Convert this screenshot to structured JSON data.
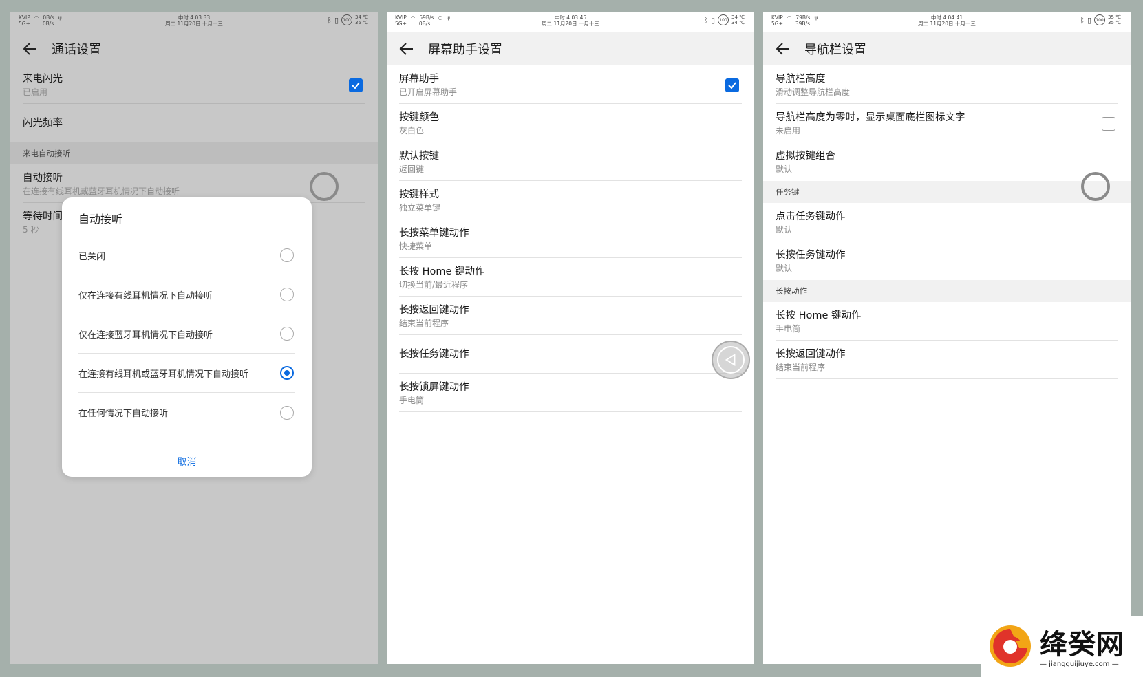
{
  "status_left": [
    "KVIP",
    "5G+"
  ],
  "phones": [
    {
      "status": {
        "speed_up": "0B/s",
        "speed_down": "0B/s",
        "time": "中时 4:03:33",
        "date": "周二 11月20日 十月十三",
        "battery": "100",
        "temp1": "34 ℃",
        "temp2": "35 ℃"
      },
      "title": "通话设置",
      "items": [
        {
          "title": "来电闪光",
          "sub": "已启用"
        },
        {
          "title": "闪光频率"
        }
      ],
      "section": "来电自动接听",
      "items2": [
        {
          "title": "自动接听",
          "sub": "在连接有线耳机或蓝牙耳机情况下自动接听"
        },
        {
          "title": "等待时间",
          "sub": "5 秒"
        }
      ],
      "dialog": {
        "title": "自动接听",
        "options": [
          "已关闭",
          "仅在连接有线耳机情况下自动接听",
          "仅在连接蓝牙耳机情况下自动接听",
          "在连接有线耳机或蓝牙耳机情况下自动接听",
          "在任何情况下自动接听"
        ],
        "selected_index": 3,
        "cancel": "取消"
      }
    },
    {
      "status": {
        "speed_up": "59B/s",
        "speed_down": "0B/s",
        "time": "中时 4:03:45",
        "date": "周二 11月20日 十月十三",
        "battery": "100",
        "temp1": "34 ℃",
        "temp2": "34 ℃"
      },
      "title": "屏幕助手设置",
      "items": [
        {
          "title": "屏幕助手",
          "sub": "已开启屏幕助手"
        },
        {
          "title": "按键颜色",
          "sub": "灰白色"
        },
        {
          "title": "默认按键",
          "sub": "返回键"
        },
        {
          "title": "按键样式",
          "sub": "独立菜单键"
        },
        {
          "title": "长按菜单键动作",
          "sub": "快捷菜单"
        },
        {
          "title": "长按 Home 键动作",
          "sub": "切换当前/最近程序"
        },
        {
          "title": "长按返回键动作",
          "sub": "结束当前程序"
        },
        {
          "title": "长按任务键动作"
        },
        {
          "title": "长按锁屏键动作",
          "sub": "手电筒"
        }
      ]
    },
    {
      "status": {
        "speed_up": "79B/s",
        "speed_down": "39B/s",
        "time": "中时 4:04:41",
        "date": "周二 11月20日 十月十三",
        "battery": "100",
        "temp1": "35 ℃",
        "temp2": "35 ℃"
      },
      "title": "导航栏设置",
      "items": [
        {
          "title": "导航栏高度",
          "sub": "滑动调整导航栏高度"
        },
        {
          "title": "导航栏高度为零时，显示桌面底栏图标文字",
          "sub": "未启用"
        },
        {
          "title": "虚拟按键组合",
          "sub": "默认"
        }
      ],
      "section1": "任务键",
      "items2": [
        {
          "title": "点击任务键动作",
          "sub": "默认"
        },
        {
          "title": "长按任务键动作",
          "sub": "默认"
        }
      ],
      "section2": "长按动作",
      "items3": [
        {
          "title": "长按 Home 键动作",
          "sub": "手电筒"
        },
        {
          "title": "长按返回键动作",
          "sub": "结束当前程序"
        }
      ]
    }
  ],
  "watermark": {
    "name": "绛癸网",
    "url": "— jiangguijiuye.com —"
  },
  "colors": {
    "accent": "#0a6ae0",
    "backdrop": "#a5b0ab"
  }
}
